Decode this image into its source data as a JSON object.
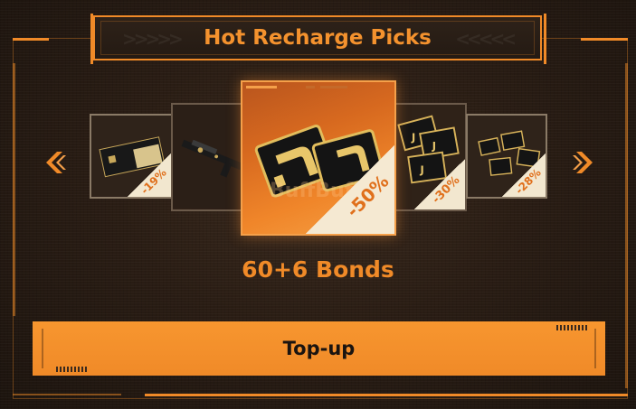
{
  "header": {
    "title": "Hot Recharge Picks"
  },
  "carousel": {
    "items": [
      {
        "id": "c1",
        "discount": "-19%"
      },
      {
        "id": "c2",
        "discount": ""
      },
      {
        "id": "c3",
        "discount": "-50%",
        "selected": true
      },
      {
        "id": "c4",
        "discount": "-30%"
      },
      {
        "id": "c5",
        "discount": "-28%"
      }
    ],
    "watermark": "BuffBuff"
  },
  "selected": {
    "label": "60+6 Bonds"
  },
  "actions": {
    "topup_label": "Top-up"
  },
  "colors": {
    "accent": "#f08a28",
    "background": "#1a1410",
    "text_dark": "#1a1410"
  },
  "icons": {
    "prev": "chevron-left-icon",
    "next": "chevron-right-icon"
  }
}
